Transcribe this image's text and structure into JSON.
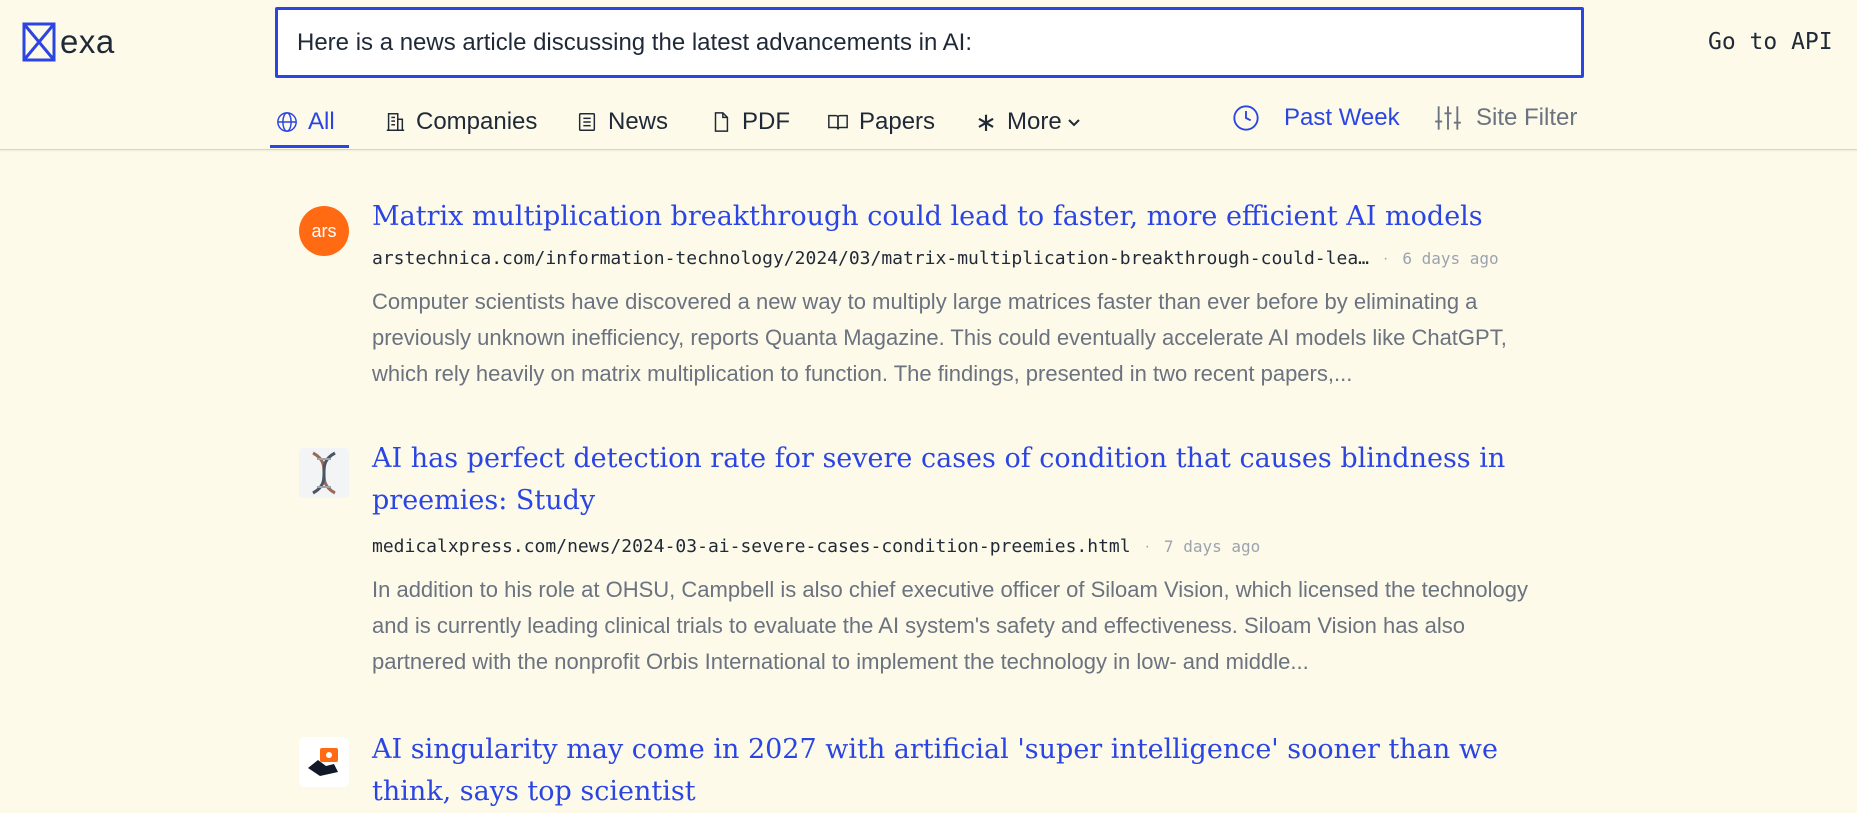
{
  "app": {
    "logo_text": "exa",
    "api_link": "Go to API"
  },
  "search": {
    "value": "Here is a news article discussing the latest advancements in AI:"
  },
  "tabs": [
    {
      "label": "All",
      "icon": "globe-icon",
      "active": true
    },
    {
      "label": "Companies",
      "icon": "building-icon"
    },
    {
      "label": "News",
      "icon": "newspaper-icon"
    },
    {
      "label": "PDF",
      "icon": "document-icon"
    },
    {
      "label": "Papers",
      "icon": "book-icon"
    },
    {
      "label": "More",
      "icon": "asterisk-icon"
    }
  ],
  "filters": {
    "date_label": "Past Week",
    "site_label": "Site Filter"
  },
  "colors": {
    "background": "#fdfae9",
    "accent": "#2b45e3",
    "muted": "#9ca3af",
    "ars_orange": "#ff6a13"
  },
  "results": [
    {
      "favicon_text": "ars",
      "title": "Matrix multiplication breakthrough could lead to faster, more efficient AI models",
      "url": "arstechnica.com/information-technology/2024/03/matrix-multiplication-breakthrough-could-lea…",
      "date": "6 days ago",
      "snippet": "Computer scientists have discovered a new way to multiply large matrices faster than ever before by eliminating a previously unknown inefficiency, reports Quanta Magazine. This could eventually accelerate AI models like ChatGPT, which rely heavily on matrix multiplication to function. The findings, presented in two recent papers,..."
    },
    {
      "favicon_text": "",
      "title": "AI has perfect detection rate for severe cases of condition that causes blindness in preemies: Study",
      "url": "medicalxpress.com/news/2024-03-ai-severe-cases-condition-preemies.html",
      "date": "7 days ago",
      "snippet": "In addition to his role at OHSU, Campbell is also chief executive officer of Siloam Vision, which licensed the technology and is currently leading clinical trials to evaluate the AI system's safety and effectiveness. Siloam Vision has also partnered with the nonprofit Orbis International to implement the technology in low- and middle..."
    },
    {
      "favicon_text": "",
      "title": "AI singularity may come in 2027 with artificial 'super intelligence' sooner than we think, says top scientist"
    }
  ]
}
